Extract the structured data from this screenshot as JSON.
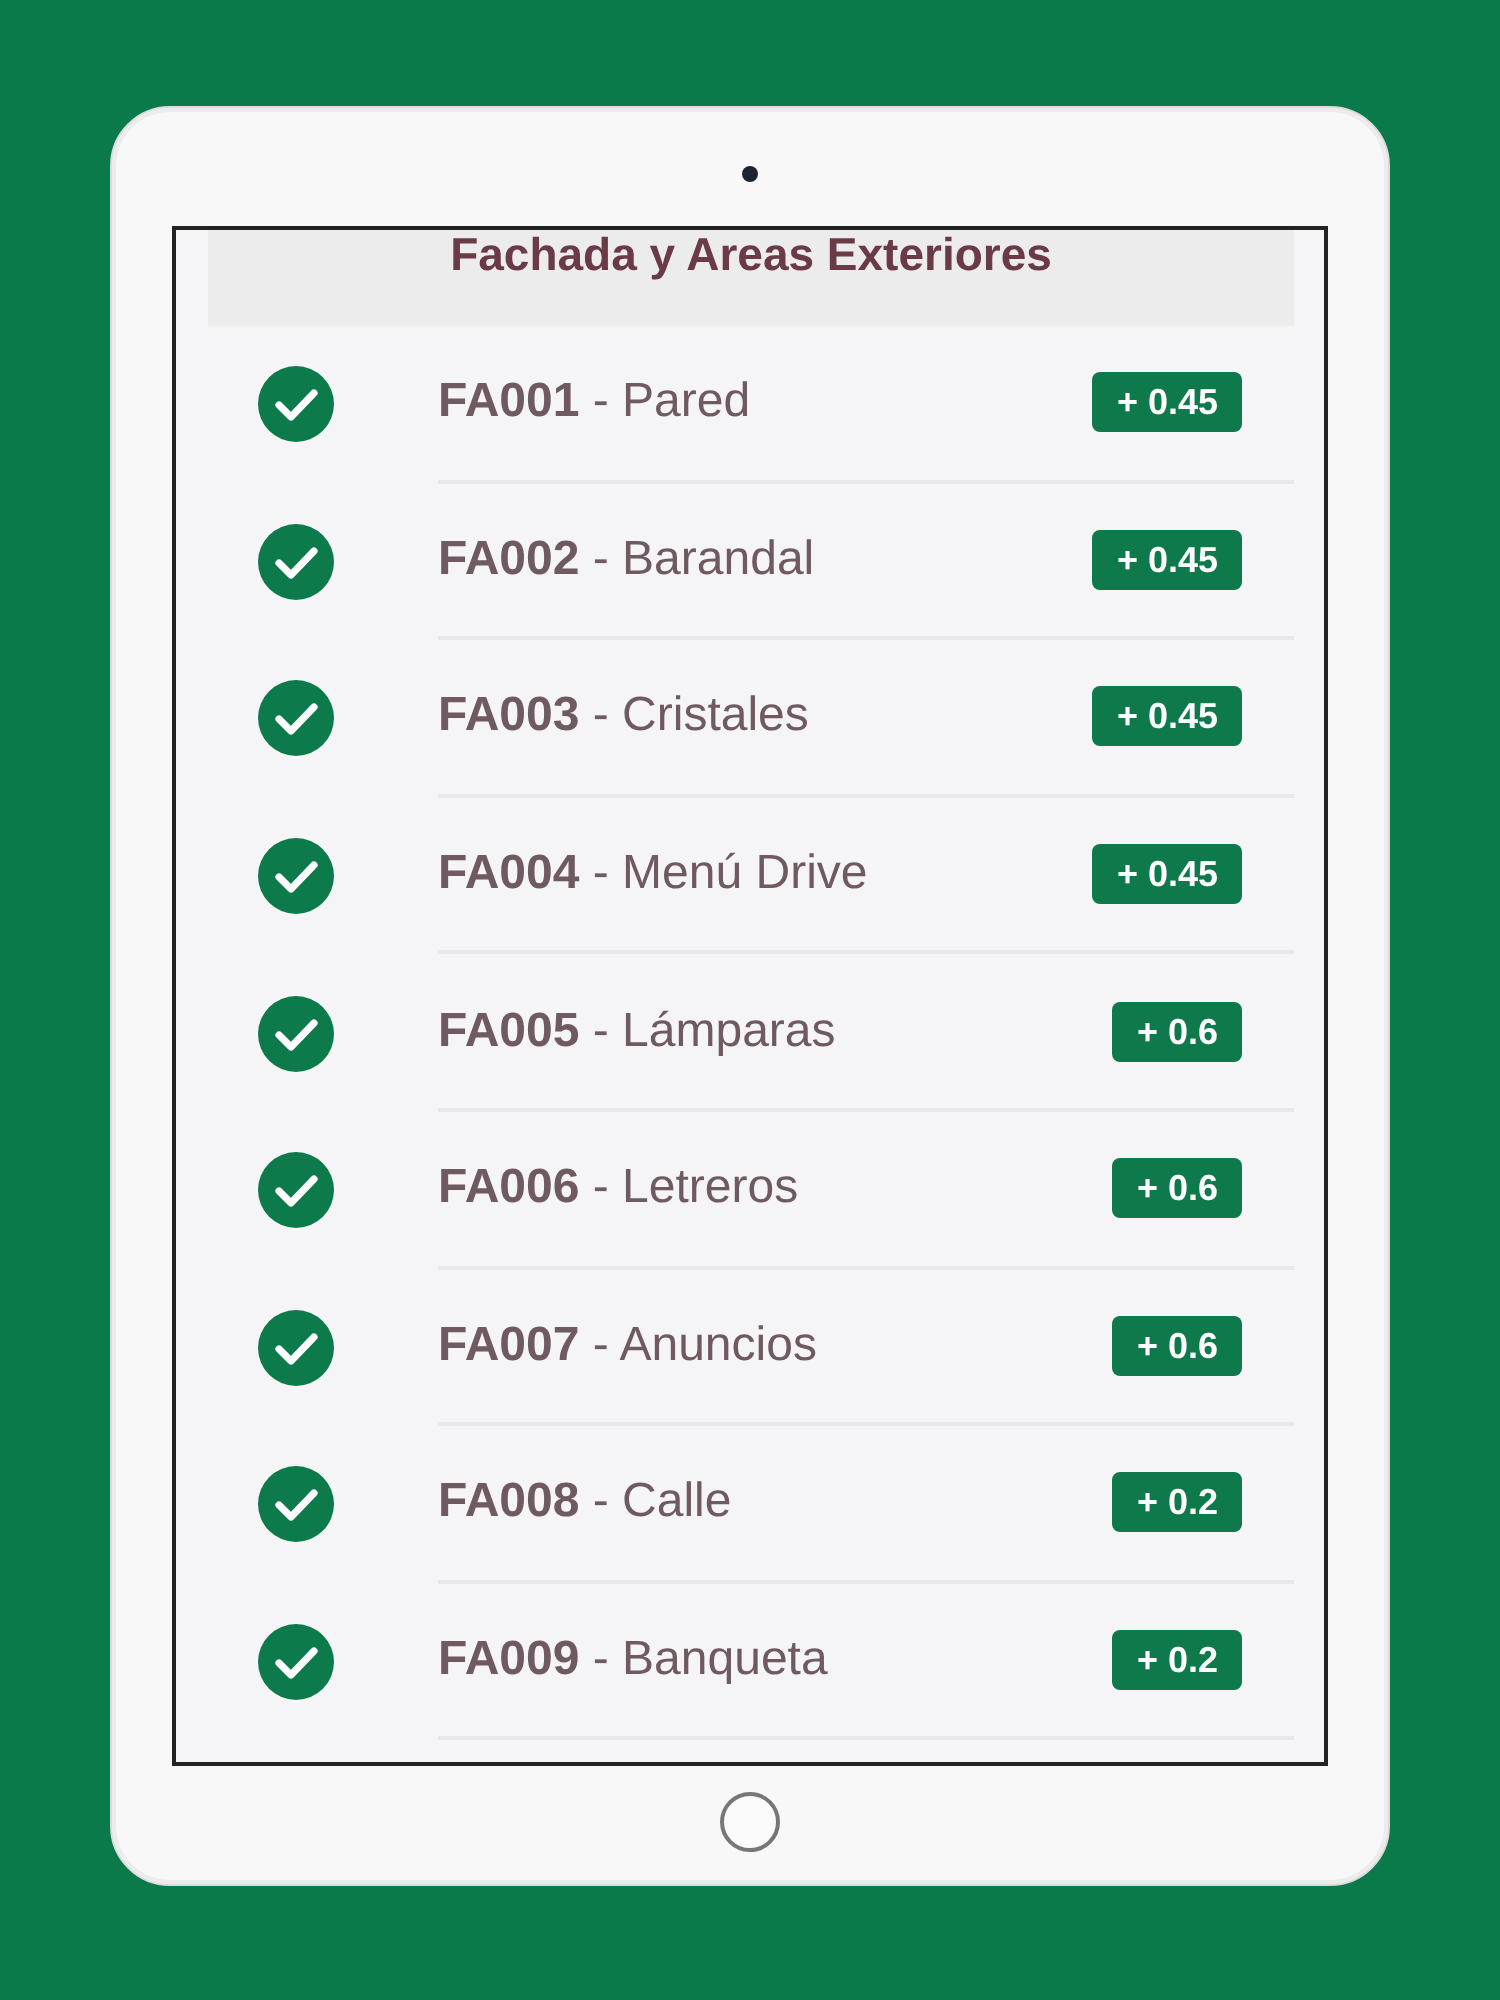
{
  "header": {
    "title": "Fachada y Areas Exteriores"
  },
  "items": [
    {
      "label": "**FA001** - Pared",
      "checked": true,
      "badge": "+ 0.45"
    },
    {
      "label": "**FA002** - Barandal",
      "checked": true,
      "badge": "+ 0.45"
    },
    {
      "label": "**FA003** - Cristales",
      "checked": true,
      "badge": "+ 0.45"
    },
    {
      "label": "**FA004** - Menú Drive",
      "checked": true,
      "badge": "+ 0.45"
    },
    {
      "label": "**FA005** - Lámparas",
      "checked": true,
      "badge": "+ 0.6"
    },
    {
      "label": "**FA006** - Letreros",
      "checked": true,
      "badge": "+ 0.6"
    },
    {
      "label": "**FA007** - Anuncios",
      "checked": true,
      "badge": "+ 0.6"
    },
    {
      "label": "**FA008** - Calle",
      "checked": true,
      "badge": "+ 0.2"
    },
    {
      "label": "**FA009** - Banqueta",
      "checked": true,
      "badge": "+ 0.2"
    }
  ]
}
